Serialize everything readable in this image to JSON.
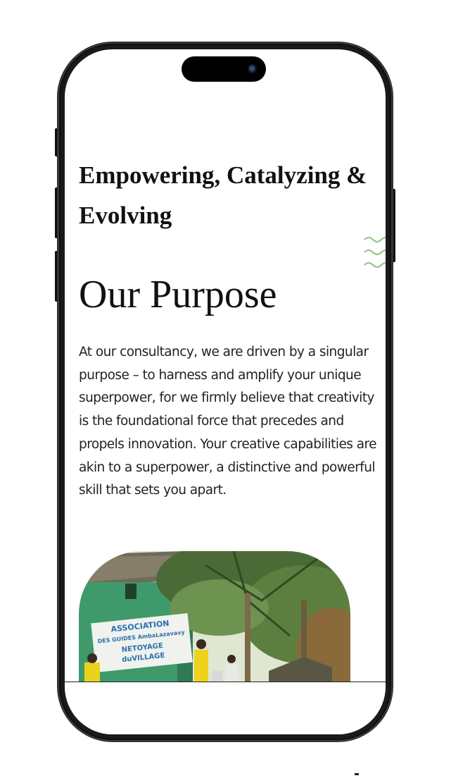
{
  "page": {
    "tagline": "Empowering, Catalyzing & Evolving",
    "heading": "Our Purpose",
    "body": "At our consultancy, we are driven by a singular purpose – to harness and amplify your unique superpower, for we firmly believe that creativity is the foundational force that precedes and propels innovation. Your creative capabilities are akin to a superpower, a distinctive and powerful skill that sets you apart."
  },
  "photo": {
    "banner_line1": "ASSOCIATION",
    "banner_line2": "DES GUIDES AmbaLazavavy",
    "banner_line3": "NETOYAGE",
    "banner_line4": "duVILLAGE"
  },
  "colors": {
    "accent_wave": "#8cc47a",
    "text": "#111111",
    "frame": "#0d0d0d"
  },
  "icons": {
    "decoration": "wave-lines-icon",
    "camera": "front-camera-icon"
  }
}
